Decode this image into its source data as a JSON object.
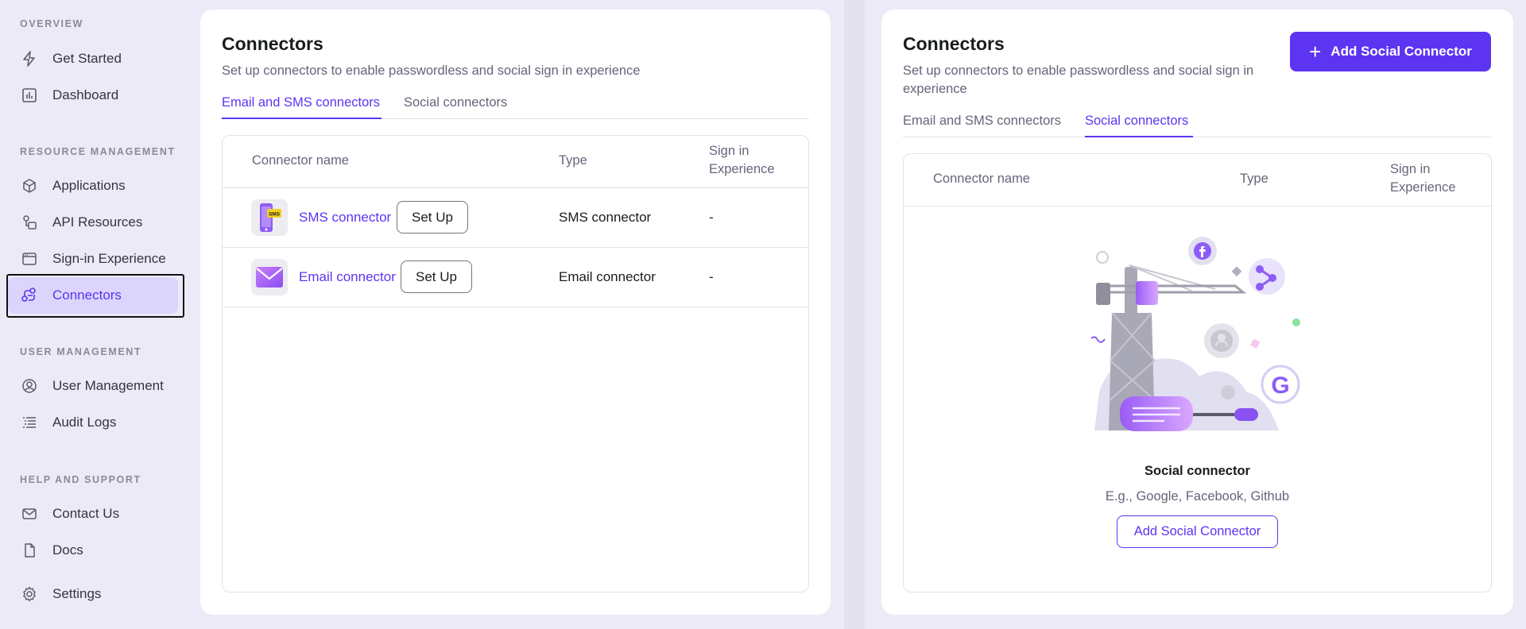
{
  "sidebar": {
    "sections": [
      {
        "title": "OVERVIEW"
      },
      {
        "title": "RESOURCE MANAGEMENT"
      },
      {
        "title": "USER MANAGEMENT"
      },
      {
        "title": "HELP AND SUPPORT"
      }
    ],
    "items": [
      {
        "label": "Get Started",
        "icon": "bolt-icon"
      },
      {
        "label": "Dashboard",
        "icon": "bar-chart-icon"
      },
      {
        "label": "Applications",
        "icon": "cube-icon"
      },
      {
        "label": "API Resources",
        "icon": "api-icon"
      },
      {
        "label": "Sign-in Experience",
        "icon": "browser-icon"
      },
      {
        "label": "Connectors",
        "icon": "connector-icon",
        "active": true
      },
      {
        "label": "User Management",
        "icon": "user-circle-icon"
      },
      {
        "label": "Audit Logs",
        "icon": "list-icon"
      },
      {
        "label": "Contact Us",
        "icon": "mail-icon"
      },
      {
        "label": "Docs",
        "icon": "document-icon"
      },
      {
        "label": "Settings",
        "icon": "gear-icon"
      }
    ]
  },
  "left": {
    "title": "Connectors",
    "subtitle": "Set up connectors to enable passwordless and social sign in experience",
    "tabs": [
      {
        "label": "Email and SMS connectors",
        "active": true
      },
      {
        "label": "Social connectors",
        "active": false
      }
    ],
    "columns": {
      "name": "Connector name",
      "type": "Type",
      "sie": "Sign in Experience"
    },
    "rows": [
      {
        "name": "SMS connector",
        "action": "Set Up",
        "type": "SMS connector",
        "sie": "-",
        "logo": "sms-icon"
      },
      {
        "name": "Email connector",
        "action": "Set Up",
        "type": "Email connector",
        "sie": "-",
        "logo": "email-icon"
      }
    ]
  },
  "right": {
    "title": "Connectors",
    "subtitle": "Set up connectors to enable passwordless and social sign in experience",
    "add_button": "Add Social Connector",
    "tabs": [
      {
        "label": "Email and SMS connectors",
        "active": false
      },
      {
        "label": "Social connectors",
        "active": true
      }
    ],
    "columns": {
      "name": "Connector name",
      "type": "Type",
      "sie": "Sign in Experience"
    },
    "empty": {
      "title": "Social connector",
      "subtitle": "E.g., Google, Facebook, Github",
      "button": "Add Social Connector"
    }
  },
  "colors": {
    "accent": "#5d34f2",
    "active_bg": "#dcd5fb",
    "page_bg": "#eceaf7"
  }
}
